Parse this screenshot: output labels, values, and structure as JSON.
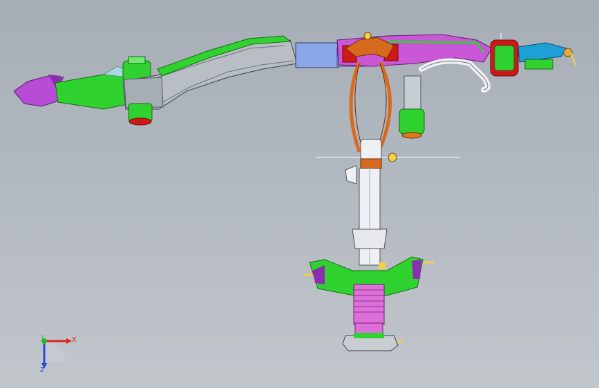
{
  "viewport": {
    "background_top": "#a6adb6",
    "background_bottom": "#c1c6cb"
  },
  "colors": {
    "frame_gray": "#b8bec4",
    "bushing_green": "#2fd22f",
    "arm_purple": "#b84cd6",
    "mount_blue": "#8aa6e6",
    "accent_red": "#d01818",
    "strut_white": "#eef0f3",
    "link_orange": "#d86a1e",
    "spring_pink": "#dd6fd8",
    "ball_joint_teal": "#1d9fd8"
  },
  "triad": {
    "x_label": "X",
    "y_label": "Y",
    "z_label": "Z",
    "x_color": "#e02020",
    "y_color": "#28b828",
    "z_color": "#2848d8"
  }
}
